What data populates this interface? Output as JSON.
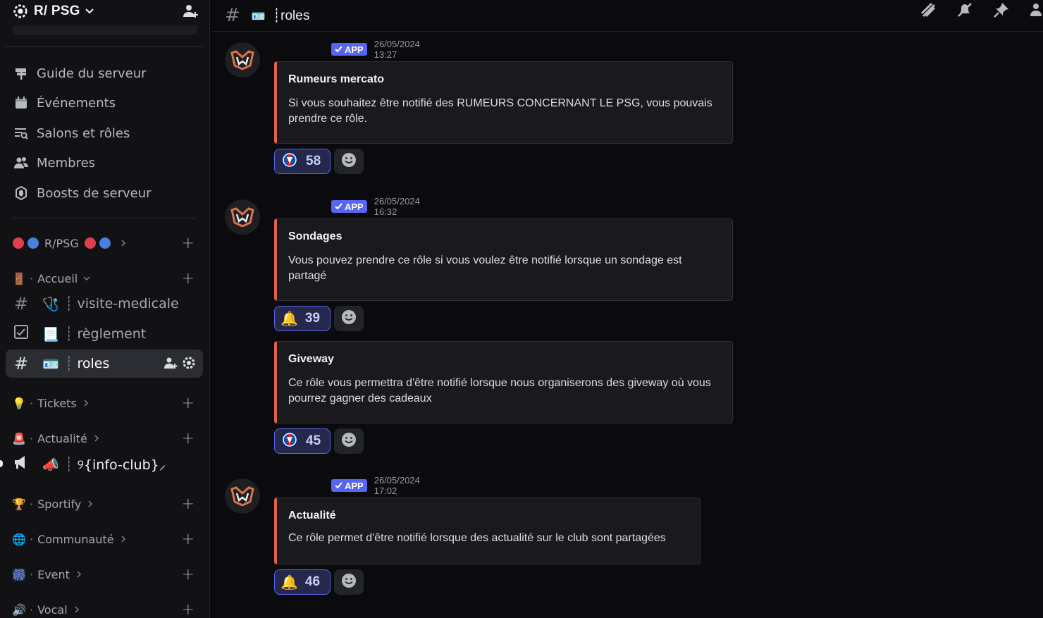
{
  "server": {
    "name": "R/ PSG"
  },
  "nav": [
    {
      "label": "Guide du serveur",
      "icon": "signpost-icon"
    },
    {
      "label": "Événements",
      "icon": "calendar-icon"
    },
    {
      "label": "Salons et rôles",
      "icon": "channels-roles-icon"
    },
    {
      "label": "Membres",
      "icon": "members-icon"
    },
    {
      "label": "Boosts de serveur",
      "icon": "boost-icon"
    }
  ],
  "categories": {
    "rpsg": {
      "label": "R/PSG"
    },
    "accueil": {
      "label": "Accueil",
      "emoji": "🚪"
    },
    "tickets": {
      "label": "Tickets",
      "emoji": "💡"
    },
    "actualite": {
      "label": "Actualité",
      "emoji": "🚨"
    },
    "sportify": {
      "label": "Sportify",
      "emoji": "🏆"
    },
    "communaute": {
      "label": "Communauté",
      "emoji": "🌐"
    },
    "event": {
      "label": "Event",
      "emoji": "🎆"
    },
    "vocal": {
      "label": "Vocal",
      "emoji": "🔊"
    }
  },
  "channels": {
    "visite": {
      "label": "visite-medicale",
      "emoji": "🩺",
      "sep": "┊"
    },
    "reglement": {
      "label": "règlement",
      "emoji": "📃",
      "sep": "┊"
    },
    "roles": {
      "label": "roles",
      "emoji": "🪪",
      "sep": "┊"
    },
    "infoclub": {
      "label": "୨{info-club}⸝",
      "emoji": "📣",
      "sep": "┊"
    }
  },
  "topbar": {
    "title": "┊roles",
    "emoji": "🪪"
  },
  "messages": [
    {
      "badge": "APP",
      "time": "26/05/2024 13:27",
      "embeds": [
        {
          "title": "Rumeurs mercato",
          "desc": "Si vous souhaitez être notifié des RUMEURS CONCERNANT LE PSG, vous pouvais prendre ce rôle.",
          "reaction": {
            "emoji": "psg-crest",
            "count": "58"
          }
        }
      ]
    },
    {
      "badge": "APP",
      "time": "26/05/2024 16:32",
      "embeds": [
        {
          "title": "Sondages",
          "desc": "Vous pouvez prendre ce rôle si vous voulez être notifié lorsque un sondage est partagé",
          "reaction": {
            "emoji": "🔔",
            "count": "39"
          }
        },
        {
          "title": "Giveway",
          "desc": "Ce rôle vous permettra d'être notifié lorsque nous organiserons des giveway où vous pourrez gagner des cadeaux",
          "reaction": {
            "emoji": "psg-crest",
            "count": "45"
          }
        }
      ]
    },
    {
      "badge": "APP",
      "time": "26/05/2024 17:02",
      "embeds": [
        {
          "title": "Actualité",
          "desc": "Ce rôle permet d'être notifié lorsque des actualité sur le club sont partagées",
          "reaction": {
            "emoji": "🔔",
            "count": "46"
          }
        }
      ]
    }
  ],
  "colors": {
    "accent": "#5865f2",
    "embed_border": "#e0614a",
    "bg": "#0b0b0d",
    "sidebar": "#121214"
  }
}
